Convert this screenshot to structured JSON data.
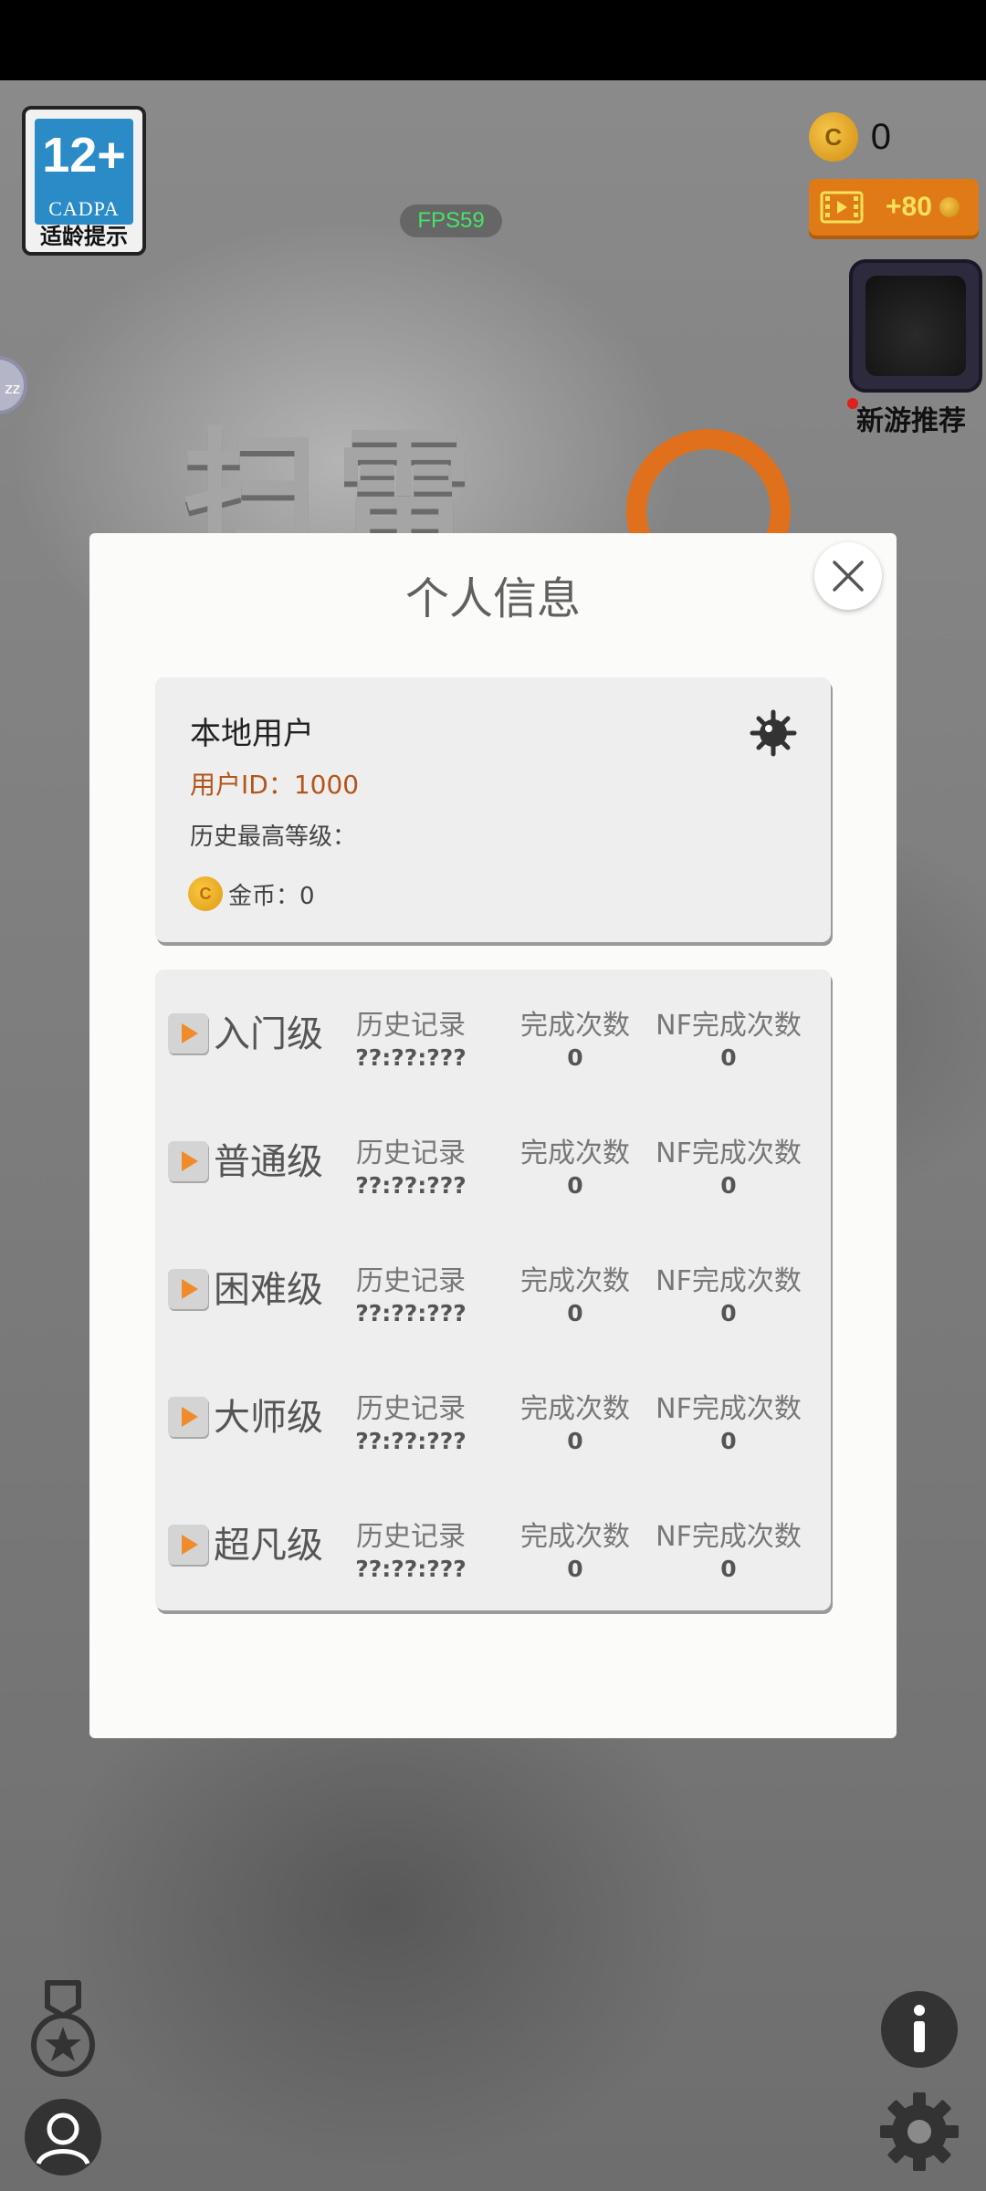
{
  "age_rating": {
    "number": "12+",
    "org": "CADPA",
    "label": "适龄提示"
  },
  "fps": "FPS59",
  "coins": {
    "value": "0",
    "coin_letter": "C"
  },
  "video_reward": {
    "label": "+80"
  },
  "new_game": {
    "label": "新游推荐"
  },
  "side_bubble": "zz",
  "background_title": "扫雷",
  "dialog": {
    "title": "个人信息",
    "user": {
      "name": "本地用户",
      "id_text": "用户ID：1000",
      "best_level": "历史最高等级：",
      "coins_text": "金币：0",
      "coin_letter": "C"
    },
    "columns": {
      "history": "历史记录",
      "completions": "完成次数",
      "nf_completions": "NF完成次数"
    },
    "levels": [
      {
        "name": "入门级",
        "history": "??:??:???",
        "completions": "0",
        "nf_completions": "0"
      },
      {
        "name": "普通级",
        "history": "??:??:???",
        "completions": "0",
        "nf_completions": "0"
      },
      {
        "name": "困难级",
        "history": "??:??:???",
        "completions": "0",
        "nf_completions": "0"
      },
      {
        "name": "大师级",
        "history": "??:??:???",
        "completions": "0",
        "nf_completions": "0"
      },
      {
        "name": "超凡级",
        "history": "??:??:???",
        "completions": "0",
        "nf_completions": "0"
      }
    ]
  },
  "colors": {
    "accent_orange": "#e07a17",
    "user_id": "#b4551a",
    "fps_green": "#46e36a"
  },
  "icons": [
    "close-icon",
    "mine-icon",
    "medal-icon",
    "user-icon",
    "info-icon",
    "gear-icon",
    "film-icon",
    "coin-icon",
    "play-icon"
  ]
}
